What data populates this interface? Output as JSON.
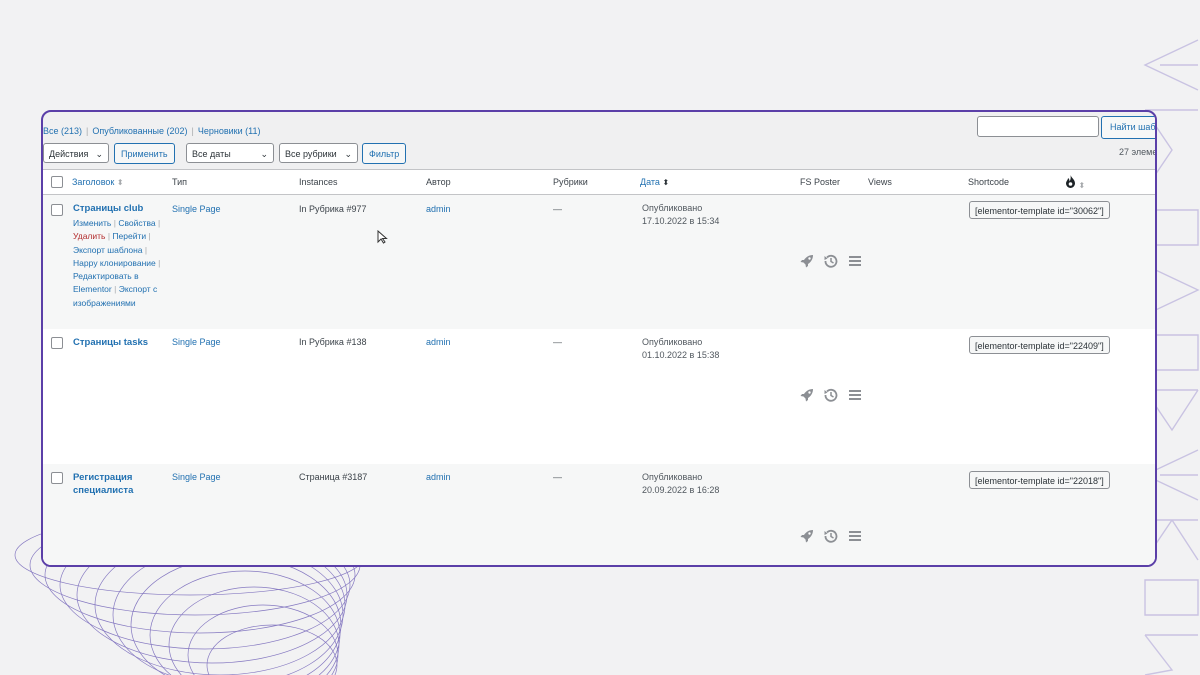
{
  "views": {
    "all": "Все (213)",
    "published": "Опубликованные (202)",
    "drafts": "Черновики (11)"
  },
  "search": {
    "placeholder": "",
    "button": "Найти шабл"
  },
  "toolbar": {
    "bulk_actions": "Действия",
    "apply": "Применить",
    "dates": "Все даты",
    "categories": "Все рубрики",
    "filter": "Фильтр",
    "count": "27 элеме"
  },
  "columns": {
    "title": "Заголовок",
    "type": "Тип",
    "instances": "Instances",
    "author": "Автор",
    "categories": "Рубрики",
    "date": "Дата",
    "fs_poster": "FS Poster",
    "views": "Views",
    "shortcode": "Shortcode"
  },
  "rows": [
    {
      "title": "Страницы club",
      "type": "Single Page",
      "instances": "In Рубрика #977",
      "author": "admin",
      "categories": "—",
      "status": "Опубликовано",
      "date": "17.10.2022 в 15:34",
      "shortcode": "[elementor-template id=\"30062\"]",
      "actions": {
        "edit": "Изменить",
        "props": "Свойства",
        "delete": "Удалить",
        "view": "Перейти",
        "export": "Экспорт шаблона",
        "clone": "Happy клонирование",
        "elementor": "Редактировать в Elementor",
        "export_images": "Экспорт с изображениями"
      }
    },
    {
      "title": "Страницы tasks",
      "type": "Single Page",
      "instances": "In Рубрика #138",
      "author": "admin",
      "categories": "—",
      "status": "Опубликовано",
      "date": "01.10.2022 в 15:38",
      "shortcode": "[elementor-template id=\"22409\"]"
    },
    {
      "title": "Регистрация специалиста",
      "type": "Single Page",
      "instances": "Страница #3187",
      "author": "admin",
      "categories": "—",
      "status": "Опубликовано",
      "date": "20.09.2022 в 16:28",
      "shortcode": "[elementor-template id=\"22018\"]"
    }
  ],
  "icons": {
    "row": [
      "rocket-icon",
      "history-icon",
      "menu-icon"
    ],
    "header": "flame-icon"
  },
  "colors": {
    "accent": "#2271b1",
    "frame": "#5b3fa8",
    "delete": "#b32d2e",
    "icon": "#8c8f94"
  }
}
